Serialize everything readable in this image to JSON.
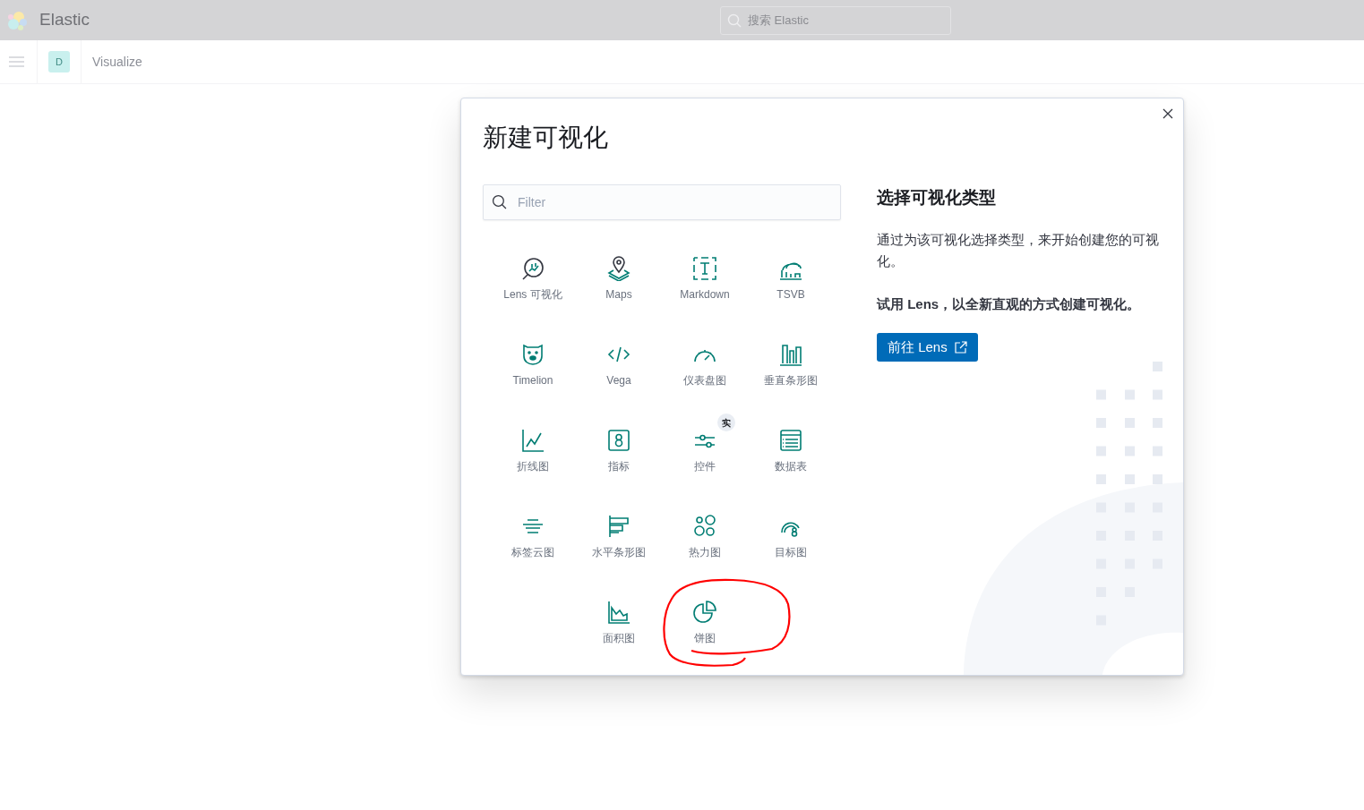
{
  "header": {
    "app_name": "Elastic",
    "search": {
      "placeholder": "搜索 Elastic"
    }
  },
  "breadcrumb": {
    "space_initial": "D",
    "page": "Visualize"
  },
  "modal": {
    "title": "新建可视化",
    "filter": {
      "placeholder": "Filter"
    },
    "types": [
      {
        "label": "Lens 可视化"
      },
      {
        "label": "Maps"
      },
      {
        "label": "Markdown"
      },
      {
        "label": "TSVB"
      },
      {
        "label": "Timelion"
      },
      {
        "label": "Vega"
      },
      {
        "label": "仪表盘图"
      },
      {
        "label": "垂直条形图"
      },
      {
        "label": "折线图"
      },
      {
        "label": "指标"
      },
      {
        "label": "控件",
        "badge": "实"
      },
      {
        "label": "数据表"
      },
      {
        "label": "标签云图"
      },
      {
        "label": "水平条形图"
      },
      {
        "label": "热力图"
      },
      {
        "label": "目标图"
      },
      {
        "label": "面积图"
      },
      {
        "label": "饼图"
      }
    ],
    "side": {
      "heading": "选择可视化类型",
      "description": "通过为该可视化选择类型，来开始创建您的可视化。",
      "promo": "试用 Lens，以全新直观的方式创建可视化。",
      "button": "前往 Lens"
    }
  }
}
